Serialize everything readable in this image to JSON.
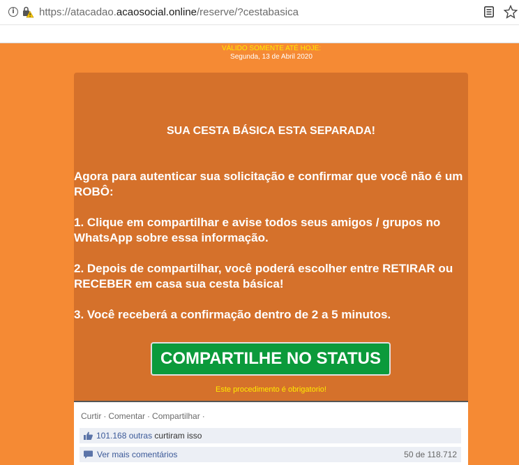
{
  "browser": {
    "url_prefix": "https://atacadao.",
    "url_host": "acaosocial.online",
    "url_path": "/reserve/?cestabasica"
  },
  "banner": {
    "validity": "VÁLIDO SOMENTE ATÉ HOJE:",
    "date": "Segunda, 13 de Abril 2020"
  },
  "card": {
    "title": "SUA CESTA BÁSICA ESTA SEPARADA!",
    "intro": "Agora para autenticar sua solicitação e confirmar que você não é um ROBÔ:",
    "step1": "1. Clique em compartilhar e avise todos seus amigos / grupos no WhatsApp sobre essa informação.",
    "step2": "2. Depois de compartilhar, você poderá escolher entre RETIRAR ou RECEBER em casa sua cesta básica!",
    "step3": "3. Você receberá a confirmação dentro de 2 a 5 minutos.",
    "share_button": "COMPARTILHE NO STATUS",
    "note": "Este procedimento é obrigatorio!"
  },
  "facebook": {
    "like": "Curtir",
    "comment": "Comentar",
    "share": "Compartilhar",
    "likes_count": "101.168 outras",
    "likes_suffix": "curtiram isso",
    "more_comments": "Ver mais comentários",
    "comments_count": "50 de 118.712"
  },
  "colors": {
    "page_bg": "#f58a34",
    "card_bg": "#d5712b",
    "button_green": "#0b9a3b",
    "highlight_yellow": "#ffea00",
    "facebook_blue": "#3b5998"
  },
  "icons": [
    "info-icon",
    "lock-warning-icon",
    "reader-view-icon",
    "star-icon",
    "thumbs-up-icon",
    "comment-icon"
  ]
}
